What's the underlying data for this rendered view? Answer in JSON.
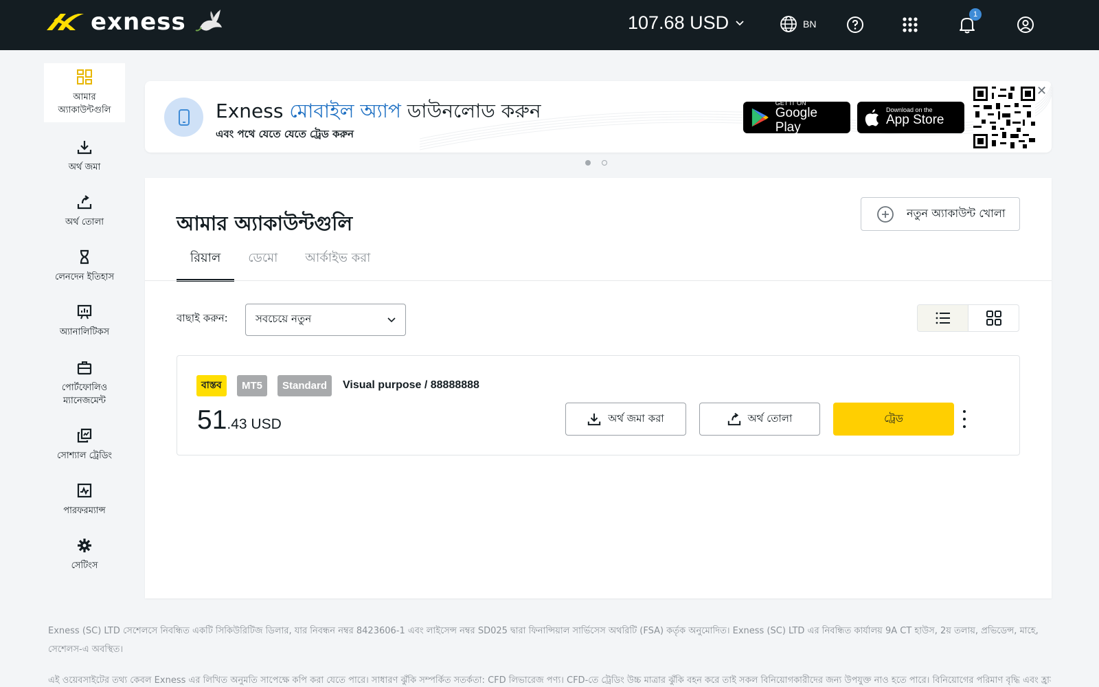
{
  "header": {
    "logo_text": "exness",
    "balance": "107.68 USD",
    "language": "BN",
    "notification_count": "1",
    "colors": {
      "background": "#141d22",
      "accent_yellow": "#ffcf01"
    }
  },
  "sidebar": {
    "items": [
      {
        "label": "আমার অ্যাকাউন্টগুলি",
        "icon": "grid-accounts-icon",
        "active": true
      },
      {
        "label": "অর্থ জমা",
        "icon": "download-icon"
      },
      {
        "label": "অর্থ তোলা",
        "icon": "withdraw-icon"
      },
      {
        "label": "লেনদেন ইতিহাস",
        "icon": "hourglass-icon"
      },
      {
        "label": "অ্যানালিটিকস",
        "icon": "analytics-board-icon"
      },
      {
        "label": "পোর্টফোলিও ম্যানেজমেন্ট",
        "icon": "briefcase-icon"
      },
      {
        "label": "সোশ্যাল ট্রেডিং",
        "icon": "copy-trading-icon"
      },
      {
        "label": "পারফরম্যান্স",
        "icon": "performance-chart-icon"
      },
      {
        "label": "সেটিংস",
        "icon": "gear-icon"
      }
    ]
  },
  "banner": {
    "title_prefix": "Exness ",
    "title_accent": "মোবাইল অ্যাপ",
    "title_suffix": " ডাউনলোড করুন",
    "subtitle": "এবং পথে যেতে যেতে ট্রেড করুন",
    "google_small": "GET IT ON",
    "google_big": "Google Play",
    "apple_small": "Download on the",
    "apple_big": "App Store",
    "close": "✕"
  },
  "main": {
    "title": "আমার অ্যাকাউন্টগুলি",
    "new_account": "নতুন অ্যাকাউন্ট খোলা",
    "tabs": [
      {
        "label": "রিয়াল",
        "active": true
      },
      {
        "label": "ডেমো"
      },
      {
        "label": "আর্কাইভ করা"
      }
    ],
    "sort_label": "বাছাই করুন:",
    "sort_value": "সবচেয়ে নতুন"
  },
  "account": {
    "tag_real": "বাস্তব",
    "tag_platform": "MT5",
    "tag_type": "Standard",
    "name": "Visual purpose / 88888888",
    "balance_int": "51",
    "balance_frac": ".43 USD",
    "deposit_label": "অর্থ জমা করা",
    "withdraw_label": "অর্থ তোলা",
    "trade_label": "ট্রেড"
  },
  "footer": {
    "p1": "Exness (SC) LTD সেশেলসে নিবন্ধিত একটি সিকিউরিটিজ ডিলার, যার নিবন্ধন নম্বর 8423606-1 এবং লাইসেন্স নম্বর SD025 দ্বারা ফিনান্সিয়াল সার্ভিসেস অথরিটি (FSA) কর্তৃক অনুমোদিত। Exness (SC) LTD এর নিবন্ধিত কার্যালয় 9A CT হাউস, 2য় তলায়, প্রভিডেন্স, মাহে, সেশেলস-এ অবস্থিত।",
    "p2": "এই ওয়েবসাইটের তথ্য কেবল Exness এর লিখিত অনুমতি সাপেক্ষে কপি করা যেতে পারে। সাধারণ ঝুঁকি সম্পর্কিত সতর্কতা: CFD লিভারেজ পণ্য। CFD-তে ট্রেডিং উচ্চ মাত্রার ঝুঁকি বহন করে তাই সকল বিনিয়োগকারীদের জন্য উপযুক্ত নাও হতে পারে। বিনিয়োগের পরিমাণ বৃদ্ধি এবং হ্রাস উভয়ই"
  }
}
